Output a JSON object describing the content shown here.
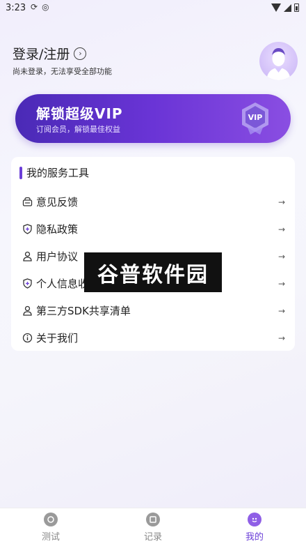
{
  "status_bar": {
    "time": "3:23",
    "icons": [
      "sync-icon",
      "notification-icon",
      "wifi-icon",
      "signal-icon",
      "battery-icon"
    ]
  },
  "profile": {
    "login_label": "登录/注册",
    "subtitle": "尚未登录，无法享受全部功能",
    "avatar_icon": "user-avatar-icon"
  },
  "vip_banner": {
    "title": "解锁超级VIP",
    "subtitle": "订阅会员，解锁最佳权益",
    "badge_text": "VIP"
  },
  "services": {
    "title": "我的服务工具",
    "items": [
      {
        "label": "意见反馈",
        "icon": "feedback-icon"
      },
      {
        "label": "隐私政策",
        "icon": "shield-icon"
      },
      {
        "label": "用户协议",
        "icon": "user-icon"
      },
      {
        "label": "个人信息收集清单",
        "icon": "shield-icon"
      },
      {
        "label": "第三方SDK共享清单",
        "icon": "user-icon"
      },
      {
        "label": "关于我们",
        "icon": "info-icon"
      }
    ]
  },
  "watermark": {
    "text": "谷普软件园"
  },
  "bottom_nav": {
    "items": [
      {
        "label": "测试",
        "icon": "test-icon",
        "active": false
      },
      {
        "label": "记录",
        "icon": "record-icon",
        "active": false
      },
      {
        "label": "我的",
        "icon": "profile-icon",
        "active": true
      }
    ]
  },
  "colors": {
    "accent": "#6b3fd8",
    "banner_start": "#4a2ab6",
    "banner_end": "#8a4ee2"
  }
}
